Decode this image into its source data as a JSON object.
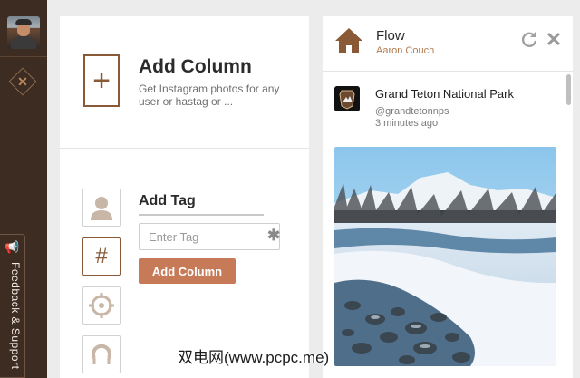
{
  "sidebar": {
    "avatar_alt": "user avatar",
    "diamond_icon": "close-diamond-icon",
    "feedback": {
      "label": "Feedback & Support",
      "icon": "megaphone-icon"
    }
  },
  "add_column": {
    "title": "Add Column",
    "subtitle": "Get Instagram photos for any user or hastag or ...",
    "options": [
      "user-icon",
      "hashtag-icon",
      "location-icon",
      "popular-icon"
    ],
    "tag_section": {
      "title": "Add Tag",
      "input_placeholder": "Enter Tag",
      "input_value": "",
      "button_label": "Add Column"
    }
  },
  "flow": {
    "title": "Flow",
    "user": "Aaron Couch",
    "icons": [
      "home-icon",
      "refresh-icon",
      "close-icon"
    ],
    "post": {
      "title": "Grand Teton National Park",
      "handle": "@grandtetonnps",
      "time": "3 minutes ago"
    }
  },
  "watermark": "双电网(www.pcpc.me)",
  "colors": {
    "accent": "#8a5a36",
    "button": "#c77a57",
    "sidebar": "#3d2c22"
  }
}
